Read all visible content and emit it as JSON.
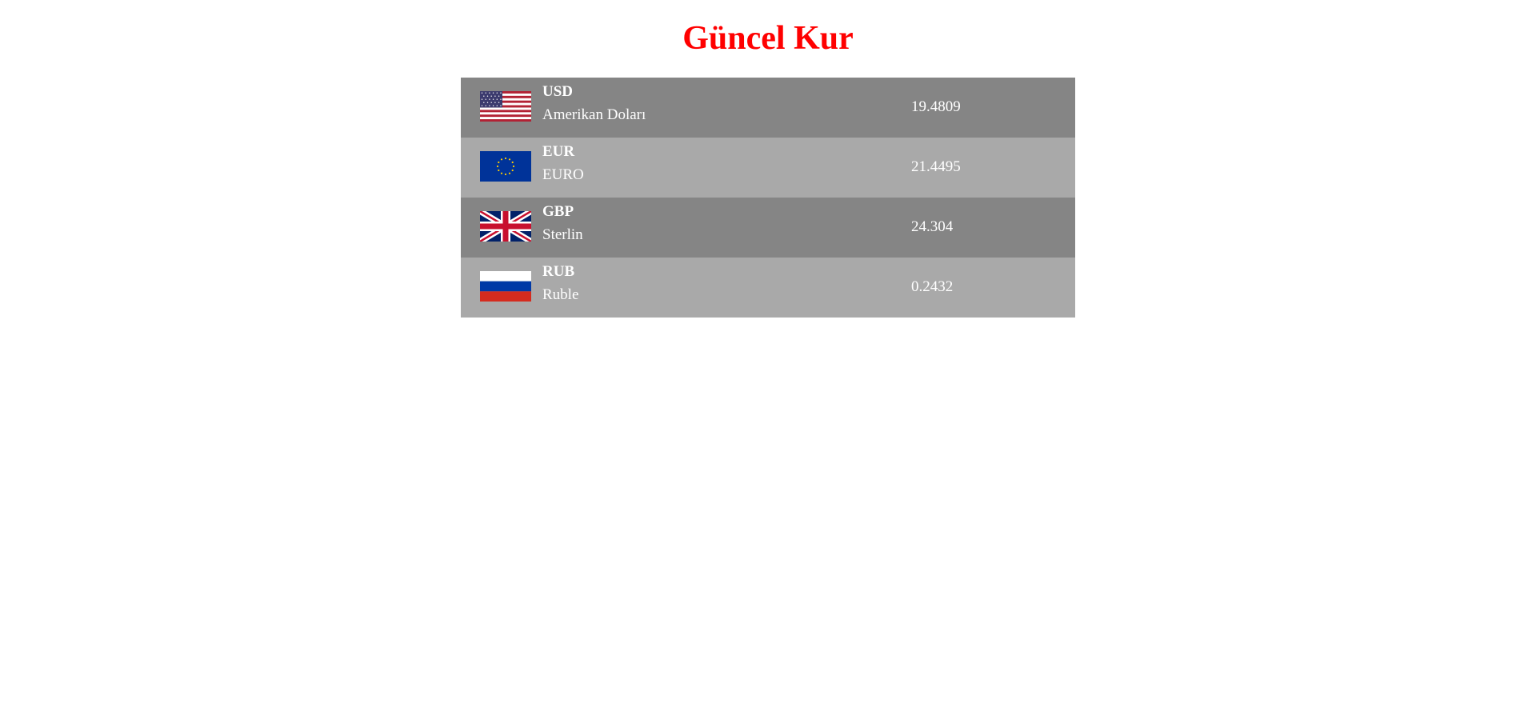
{
  "page": {
    "title": "Güncel Kur",
    "title_color": "#ff0000"
  },
  "colors": {
    "row_dark": "#858585",
    "row_light": "#a9a9a9",
    "text": "#ffffff"
  },
  "currencies": [
    {
      "code": "USD",
      "name": "Amerikan Doları",
      "rate": "19.4809",
      "flag_icon": "us-flag-icon"
    },
    {
      "code": "EUR",
      "name": "EURO",
      "rate": "21.4495",
      "flag_icon": "eu-flag-icon"
    },
    {
      "code": "GBP",
      "name": "Sterlin",
      "rate": "24.304",
      "flag_icon": "uk-flag-icon"
    },
    {
      "code": "RUB",
      "name": "Ruble",
      "rate": "0.2432",
      "flag_icon": "russia-flag-icon"
    }
  ]
}
